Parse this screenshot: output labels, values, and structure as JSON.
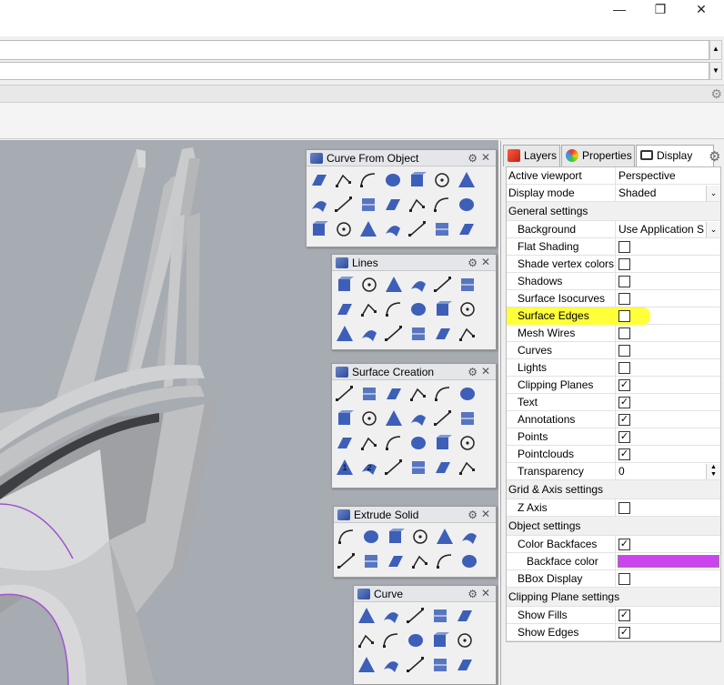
{
  "window": {
    "minimize": "—",
    "maximize": "❐",
    "close": "✕"
  },
  "command_area": {
    "up_arrow": "▲",
    "down_arrow": "▼"
  },
  "viewport_name": "Perspective",
  "panels": [
    {
      "title": "Curve From Object",
      "gear": "⚙",
      "close": "✕"
    },
    {
      "title": "Lines",
      "gear": "⚙",
      "close": "✕"
    },
    {
      "title": "Surface Creation",
      "gear": "⚙",
      "close": "✕"
    },
    {
      "title": "Extrude Solid",
      "gear": "⚙",
      "close": "✕"
    },
    {
      "title": "Curve",
      "gear": "⚙",
      "close": "✕"
    }
  ],
  "tool_labels": {
    "one": "1",
    "two": "2"
  },
  "right_tabs": [
    {
      "label": "Layers"
    },
    {
      "label": "Properties"
    },
    {
      "label": "Display"
    }
  ],
  "props": {
    "active_viewport": {
      "label": "Active viewport",
      "value": "Perspective"
    },
    "display_mode": {
      "label": "Display mode",
      "value": "Shaded"
    },
    "general_settings": "General settings",
    "background": {
      "label": "Background",
      "value": "Use Application S..."
    },
    "flat_shading": {
      "label": "Flat Shading",
      "checked": false
    },
    "shade_vertex_colors": {
      "label": "Shade vertex colors",
      "checked": false
    },
    "shadows": {
      "label": "Shadows",
      "checked": false
    },
    "surface_isocurves": {
      "label": "Surface Isocurves",
      "checked": false
    },
    "surface_edges": {
      "label": "Surface Edges",
      "checked": false
    },
    "mesh_wires": {
      "label": "Mesh Wires",
      "checked": false
    },
    "curves": {
      "label": "Curves",
      "checked": false
    },
    "lights": {
      "label": "Lights",
      "checked": false
    },
    "clipping_planes": {
      "label": "Clipping Planes",
      "checked": true
    },
    "text": {
      "label": "Text",
      "checked": true
    },
    "annotations": {
      "label": "Annotations",
      "checked": true
    },
    "points": {
      "label": "Points",
      "checked": true
    },
    "pointclouds": {
      "label": "Pointclouds",
      "checked": true
    },
    "transparency": {
      "label": "Transparency",
      "value": "0"
    },
    "grid_axis_settings": "Grid & Axis settings",
    "z_axis": {
      "label": "Z Axis",
      "checked": false
    },
    "object_settings": "Object settings",
    "color_backfaces": {
      "label": "Color Backfaces",
      "checked": true
    },
    "backface_color": {
      "label": "Backface color",
      "color": "#cc44ee"
    },
    "bbox_display": {
      "label": "BBox Display",
      "checked": false
    },
    "clipping_plane_settings": "Clipping Plane settings",
    "show_fills": {
      "label": "Show Fills",
      "checked": true
    },
    "show_edges": {
      "label": "Show Edges",
      "checked": true
    }
  },
  "colors": {
    "highlight": "#ffff3a",
    "viewport": "#a7abb2",
    "tool_blue": "#3d5fb8"
  },
  "icons": {
    "check": "✓",
    "dropdown": "⌄",
    "gear": "⚙"
  }
}
